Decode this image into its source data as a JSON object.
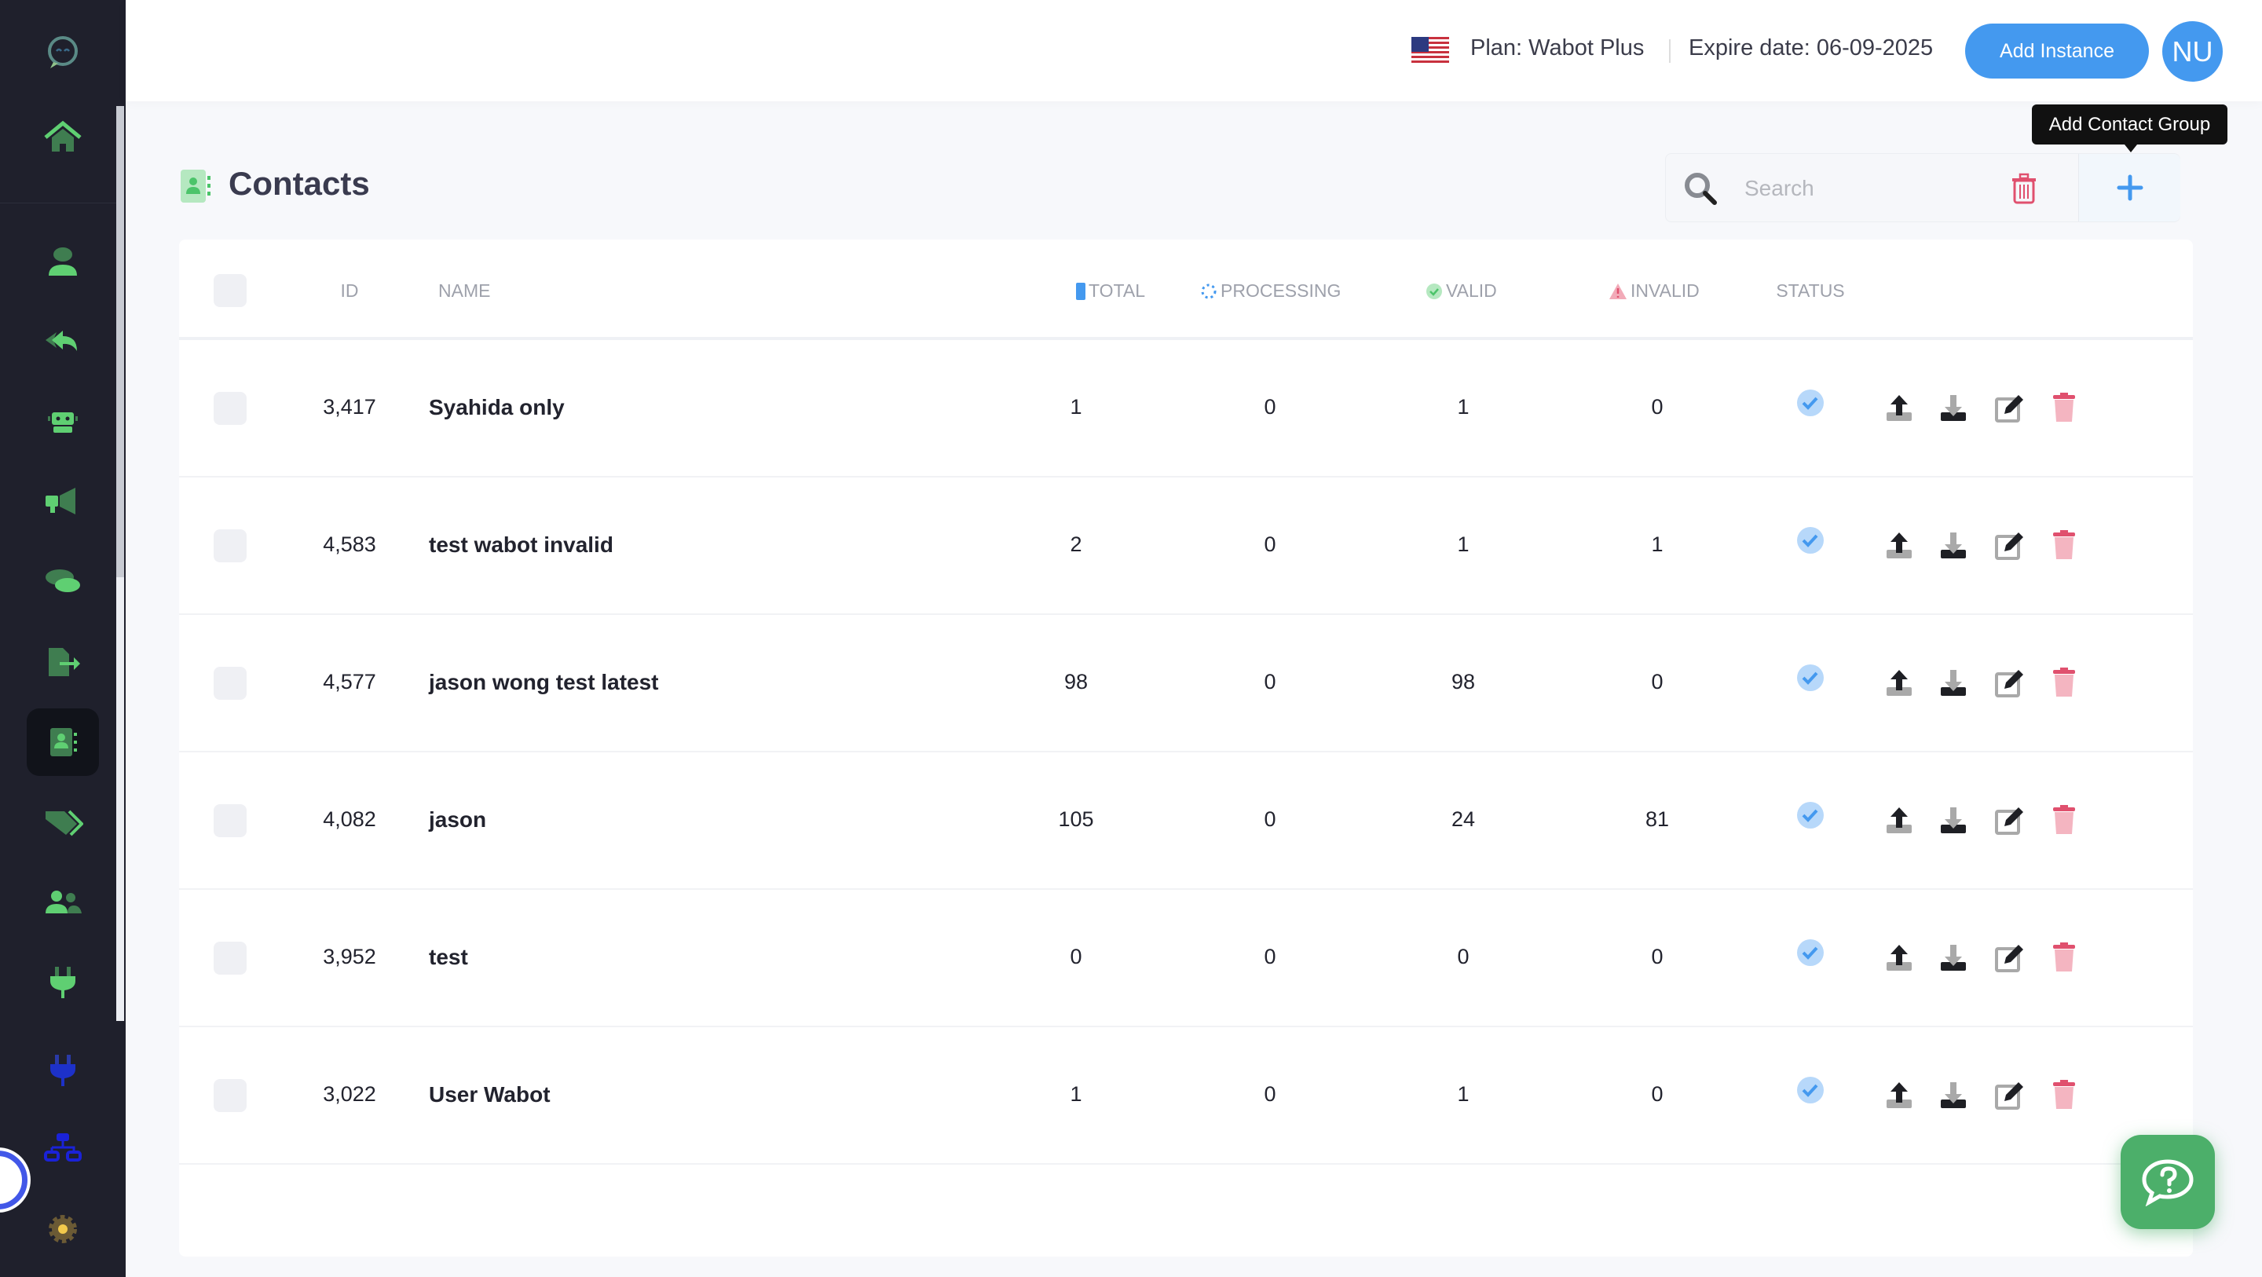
{
  "sidebar": {
    "items": [
      {
        "icon": "logo-chat-icon"
      },
      {
        "icon": "home-icon"
      },
      {
        "icon": "user-icon"
      },
      {
        "icon": "reply-all-icon"
      },
      {
        "icon": "robot-icon"
      },
      {
        "icon": "megaphone-icon"
      },
      {
        "icon": "comments-icon"
      },
      {
        "icon": "file-export-icon"
      },
      {
        "icon": "contact-book-icon",
        "active": true
      },
      {
        "icon": "tags-icon"
      },
      {
        "icon": "users-icon"
      },
      {
        "icon": "plug-icon"
      },
      {
        "icon": "plug-blue-icon"
      },
      {
        "icon": "sitemap-icon"
      },
      {
        "icon": "gear-icon"
      }
    ]
  },
  "header": {
    "plan": "Plan: Wabot Plus",
    "expire": "Expire date: 06-09-2025",
    "add_instance": "Add Instance",
    "avatar": "NU"
  },
  "tooltip": "Add Contact Group",
  "page": {
    "title": "Contacts"
  },
  "search": {
    "placeholder": "Search",
    "value": ""
  },
  "table": {
    "columns": {
      "id": "ID",
      "name": "NAME",
      "total": "TOTAL",
      "processing": "PROCESSING",
      "valid": "VALID",
      "invalid": "INVALID",
      "status": "STATUS"
    },
    "rows": [
      {
        "id": "3,417",
        "name": "Syahida only",
        "total": "1",
        "processing": "0",
        "valid": "1",
        "invalid": "0"
      },
      {
        "id": "4,583",
        "name": "test wabot invalid",
        "total": "2",
        "processing": "0",
        "valid": "1",
        "invalid": "1"
      },
      {
        "id": "4,577",
        "name": "jason wong test latest",
        "total": "98",
        "processing": "0",
        "valid": "98",
        "invalid": "0"
      },
      {
        "id": "4,082",
        "name": "jason",
        "total": "105",
        "processing": "0",
        "valid": "24",
        "invalid": "81"
      },
      {
        "id": "3,952",
        "name": "test",
        "total": "0",
        "processing": "0",
        "valid": "0",
        "invalid": "0"
      },
      {
        "id": "3,022",
        "name": "User Wabot",
        "total": "1",
        "processing": "0",
        "valid": "1",
        "invalid": "0"
      }
    ]
  },
  "colors": {
    "accent": "#4499ef",
    "sidebar": "#1f202c",
    "green": "#4caf6a",
    "danger": "#e0506e"
  }
}
